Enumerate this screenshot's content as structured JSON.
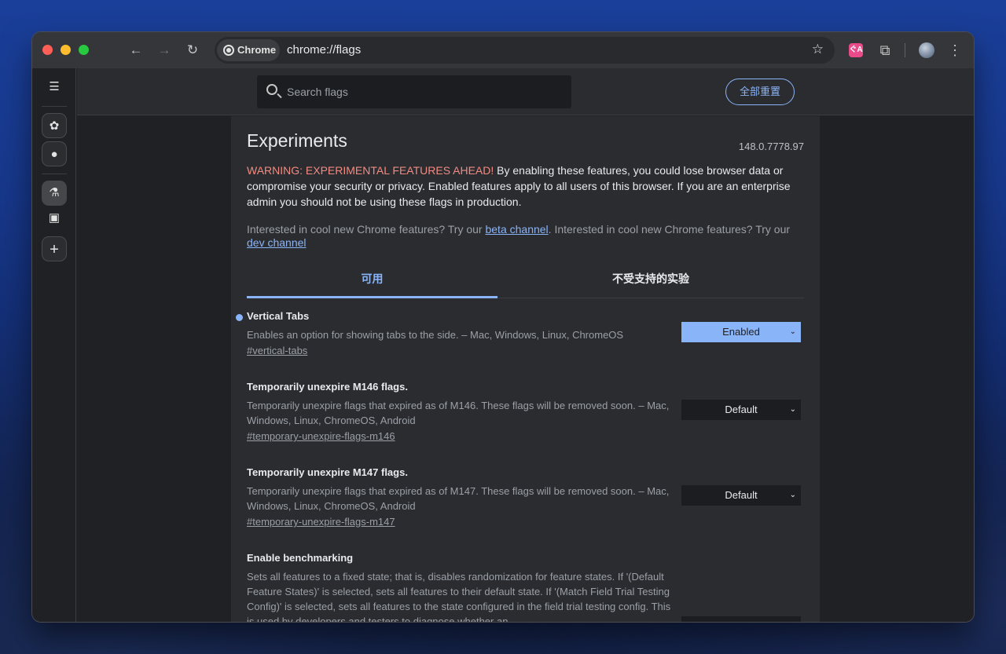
{
  "browser": {
    "chip_label": "Chrome",
    "url": "chrome://flags",
    "ext_label": "ぐA"
  },
  "header": {
    "search_placeholder": "Search flags",
    "reset_label": "全部重置"
  },
  "page": {
    "title": "Experiments",
    "version": "148.0.7778.97",
    "warning_label": "WARNING: EXPERIMENTAL FEATURES AHEAD!",
    "warning_text": " By enabling these features, you could lose browser data or compromise your security or privacy. Enabled features apply to all users of this browser. If you are an enterprise admin you should not be using these flags in production.",
    "interest_1": "Interested in cool new Chrome features? Try our ",
    "beta_link": "beta channel",
    "interest_2": ". Interested in cool new Chrome features? Try our ",
    "dev_link": "dev channel"
  },
  "tabs": [
    {
      "label": "可用"
    },
    {
      "label": "不受支持的实验"
    }
  ],
  "flags": [
    {
      "name": "Vertical Tabs",
      "desc": "Enables an option for showing tabs to the side. – Mac, Windows, Linux, ChromeOS",
      "id": "#vertical-tabs",
      "value": "Enabled"
    },
    {
      "name": "Temporarily unexpire M146 flags.",
      "desc": "Temporarily unexpire flags that expired as of M146. These flags will be removed soon. – Mac, Windows, Linux, ChromeOS, Android",
      "id": "#temporary-unexpire-flags-m146",
      "value": "Default"
    },
    {
      "name": "Temporarily unexpire M147 flags.",
      "desc": "Temporarily unexpire flags that expired as of M147. These flags will be removed soon. – Mac, Windows, Linux, ChromeOS, Android",
      "id": "#temporary-unexpire-flags-m147",
      "value": "Default"
    },
    {
      "name": "Enable benchmarking",
      "desc": "Sets all features to a fixed state; that is, disables randomization for feature states. If '(Default Feature States)' is selected, sets all features to their default state. If '(Match Field Trial Testing Config)' is selected, sets all features to the state configured in the field trial testing config. This is used by developers and testers to diagnose whether an"
    }
  ]
}
